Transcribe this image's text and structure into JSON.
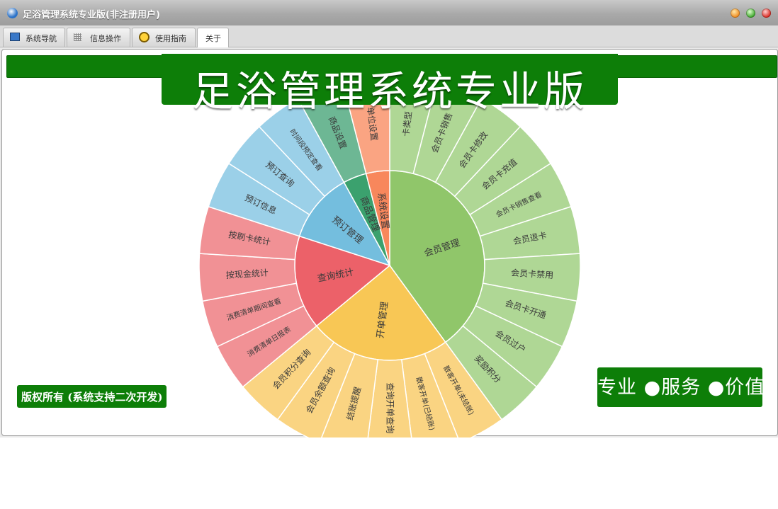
{
  "window": {
    "title": "足浴管理系统专业版(非注册用户)",
    "controls": [
      "minimize",
      "maximize",
      "close"
    ]
  },
  "tabs": [
    {
      "label": "系统导航",
      "icon": "monitor-icon"
    },
    {
      "label": "信息操作",
      "icon": "grid-icon"
    },
    {
      "label": "使用指南",
      "icon": "help-ring-icon"
    },
    {
      "label": "关于",
      "active": true
    }
  ],
  "banner": {
    "title": "足浴管理系统专业版"
  },
  "footer": {
    "copyright": "版权所有 (系统支持二次开发)",
    "slogan": "专业 ●服务 ●价值"
  },
  "colors": {
    "brand_green": "#0d7e08",
    "segment_green": "#90c66a",
    "segment_yellow": "#f8c755",
    "segment_red": "#ec6169",
    "segment_blue": "#74bede",
    "segment_teal": "#3ba16e",
    "segment_orange": "#f8875c"
  },
  "chart_data": {
    "type": "sunburst",
    "groups": [
      {
        "name": "会员管理",
        "color": "#90c66a",
        "outer_color": "#afd795",
        "children": [
          "卡类型",
          "会员卡销售",
          "会员卡修改",
          "会员卡充值",
          "会员卡销售查看",
          "会员退卡",
          "会员卡禁用",
          "会员卡开通",
          "会员过户",
          "奖励积分"
        ]
      },
      {
        "name": "开单管理",
        "color": "#f8c755",
        "outer_color": "#fad482",
        "children": [
          "散客开单(未结账)",
          "散客开单(已结账)",
          "查询开单查询",
          "结账提醒",
          "会员余额查询",
          "会员积分查询"
        ]
      },
      {
        "name": "查询统计",
        "color": "#ec6169",
        "outer_color": "#f19195",
        "children": [
          "消费清单日报表",
          "消费清单期间查看",
          "按现金统计",
          "按刷卡统计"
        ]
      },
      {
        "name": "预订管理",
        "color": "#74bede",
        "outer_color": "#9bd0e8",
        "children": [
          "预订信息",
          "预订查询",
          "时间段预定查看"
        ]
      },
      {
        "name": "商品管理",
        "color": "#3ba16e",
        "outer_color": "#6db794",
        "children": [
          "商品设置"
        ]
      },
      {
        "name": "系统设置",
        "color": "#f8875c",
        "outer_color": "#faa482",
        "children": [
          "单位设置"
        ]
      }
    ]
  }
}
